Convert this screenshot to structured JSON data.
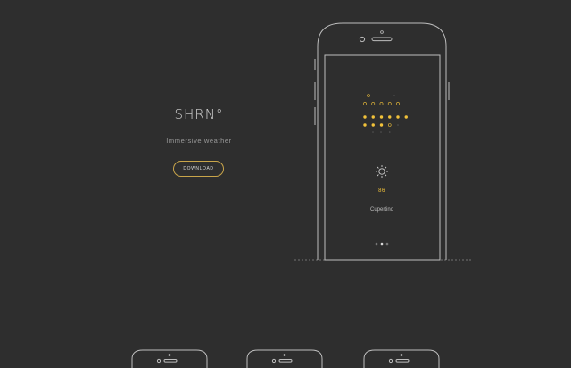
{
  "app": {
    "title": "SHRN°",
    "tagline": "Immersive weather",
    "download_label": "DOWNLOAD"
  },
  "weather": {
    "icon": "sun-icon",
    "temperature": "86",
    "city": "Cupertino"
  },
  "pager": {
    "pages": 3,
    "active": 1
  },
  "colors": {
    "background": "#2e2e2e",
    "outline": "#bfbfbf",
    "accent": "#f2c23a",
    "button_border": "#c9a54a"
  }
}
